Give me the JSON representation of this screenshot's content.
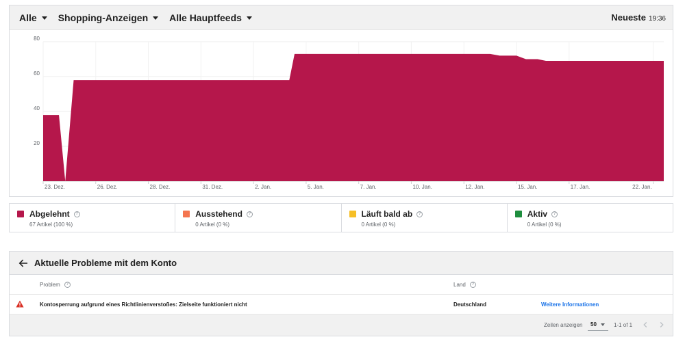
{
  "header": {
    "filters": [
      "Alle",
      "Shopping-Anzeigen",
      "Alle Hauptfeeds"
    ],
    "latest_label": "Neueste",
    "latest_time": "19:36"
  },
  "chart_data": {
    "type": "area",
    "series": [
      {
        "color": "#b5174b",
        "x": [
          0,
          1.5,
          2.1,
          2.9,
          23.4,
          23.9,
          42.5,
          43.4,
          45.0,
          45.9,
          47.0,
          47.8,
          59.0
        ],
        "values": [
          38,
          38,
          0,
          58,
          58,
          73,
          73,
          72,
          72,
          70,
          70,
          69,
          69
        ]
      }
    ],
    "ylim": [
      0,
      80
    ],
    "yticks": [
      20,
      40,
      60,
      80
    ],
    "xticks": [
      {
        "x": 0,
        "label": "23. Dez."
      },
      {
        "x": 5,
        "label": "26. Dez."
      },
      {
        "x": 10,
        "label": "28. Dez."
      },
      {
        "x": 15,
        "label": "31. Dez."
      },
      {
        "x": 20,
        "label": "2. Jan."
      },
      {
        "x": 25,
        "label": "5. Jan."
      },
      {
        "x": 30,
        "label": "7. Jan."
      },
      {
        "x": 35,
        "label": "10. Jan."
      },
      {
        "x": 40,
        "label": "12. Jan."
      },
      {
        "x": 45,
        "label": "15. Jan."
      },
      {
        "x": 50,
        "label": "17. Jan."
      },
      {
        "x": 58,
        "label": "22. Jan."
      }
    ],
    "xlim": [
      0,
      59
    ],
    "grid": true
  },
  "legend": [
    {
      "label": "Abgelehnt",
      "sub": "67 Artikel (100 %)",
      "color": "#b5174b"
    },
    {
      "label": "Ausstehend",
      "sub": "0 Artikel (0 %)",
      "color": "#f4754f"
    },
    {
      "label": "Läuft bald ab",
      "sub": "0 Artikel (0 %)",
      "color": "#f6bf26"
    },
    {
      "label": "Aktiv",
      "sub": "0 Artikel (0 %)",
      "color": "#1e8e3e"
    }
  ],
  "issues": {
    "title": "Aktuelle Probleme mit dem Konto",
    "col_problem": "Problem",
    "col_country": "Land",
    "rows": [
      {
        "problem": "Kontosperrung aufgrund eines Richtlinienverstoßes: Zielseite funktioniert nicht",
        "country": "Deutschland",
        "link": "Weitere Informationen"
      }
    ],
    "footer": {
      "rows_label": "Zeilen anzeigen",
      "rows_value": "50",
      "range": "1-1 of 1"
    }
  },
  "icons": {
    "help": "?",
    "warning": "warning-icon",
    "back": "arrow-left-icon"
  }
}
